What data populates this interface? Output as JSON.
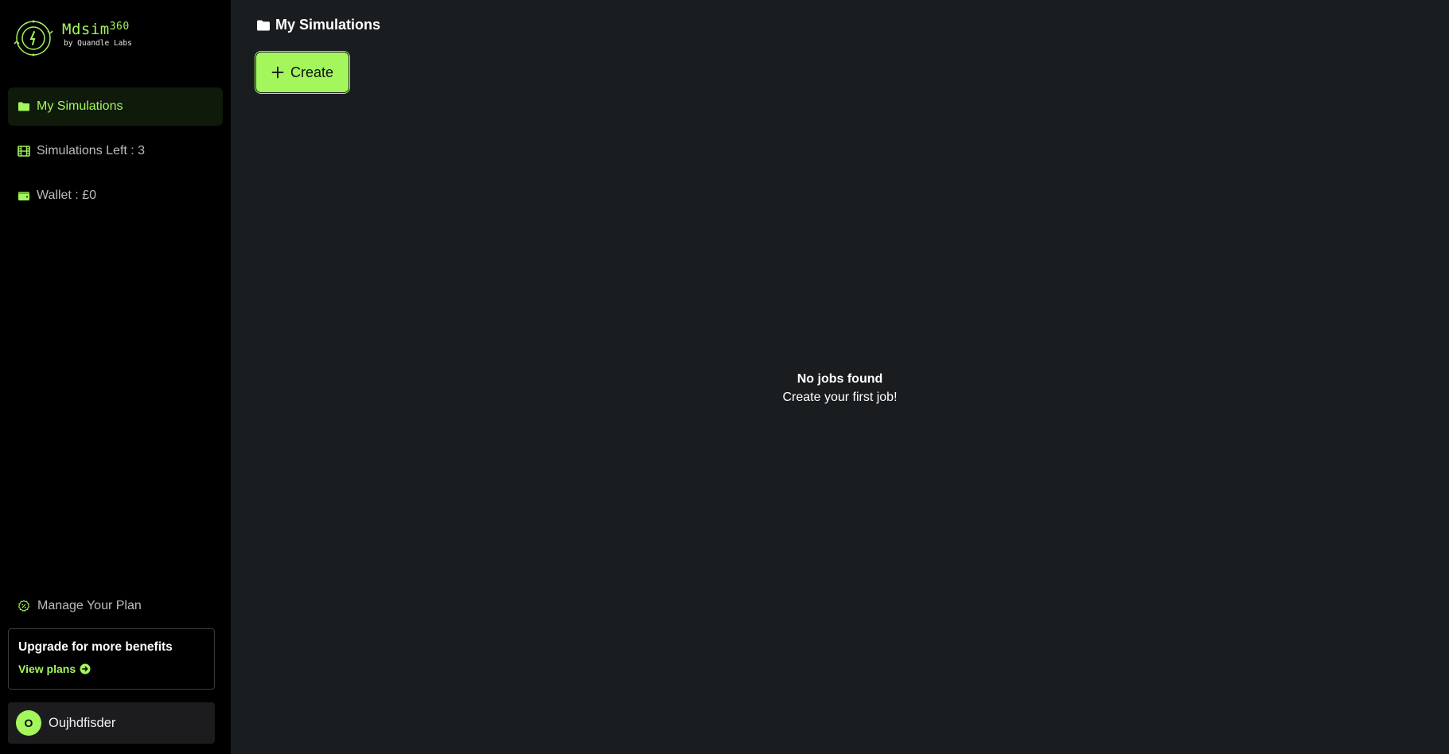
{
  "brand": {
    "name": "Mdsim",
    "superscript": "360",
    "byline": "by Quandle Labs"
  },
  "sidebar": {
    "items": [
      {
        "label": "My Simulations",
        "icon": "folder-icon",
        "active": true
      },
      {
        "label": "Simulations Left : 3",
        "icon": "film-icon",
        "active": false
      },
      {
        "label": "Wallet : £0",
        "icon": "wallet-icon",
        "active": false
      }
    ],
    "manage_plan": {
      "label": "Manage Your Plan",
      "icon": "badge-percent-icon"
    },
    "upgrade": {
      "title": "Upgrade for more benefits",
      "link_label": "View plans",
      "link_icon": "arrow-circle-right-icon"
    },
    "user": {
      "initial": "O",
      "name": "Oujhdfisder"
    }
  },
  "main": {
    "title": "My Simulations",
    "title_icon": "folder-icon",
    "create_label": "Create",
    "create_icon": "plus-icon",
    "empty_title": "No jobs found",
    "empty_subtitle": "Create your first job!"
  },
  "colors": {
    "accent": "#a3f65c",
    "sidebar_bg": "#000000",
    "main_bg": "#1a1d1f",
    "active_bg": "#0f1a0a"
  }
}
